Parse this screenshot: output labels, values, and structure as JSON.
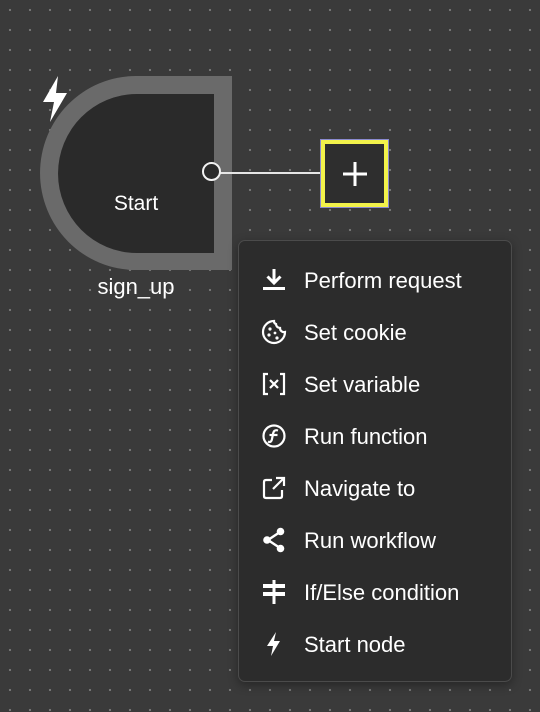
{
  "start_node": {
    "label": "Start",
    "icon": "lightning-bolt-icon",
    "caption": "sign_up"
  },
  "add_button": {
    "icon": "plus-icon",
    "highlight_color": "#f2f24a"
  },
  "menu": {
    "items": [
      {
        "label": "Perform request",
        "icon": "download-icon"
      },
      {
        "label": "Set cookie",
        "icon": "cookie-icon"
      },
      {
        "label": "Set variable",
        "icon": "variable-icon"
      },
      {
        "label": "Run function",
        "icon": "function-icon"
      },
      {
        "label": "Navigate to",
        "icon": "external-link-icon"
      },
      {
        "label": "Run workflow",
        "icon": "share-icon"
      },
      {
        "label": "If/Else condition",
        "icon": "signpost-icon"
      },
      {
        "label": "Start node",
        "icon": "lightning-bolt-icon"
      }
    ]
  }
}
